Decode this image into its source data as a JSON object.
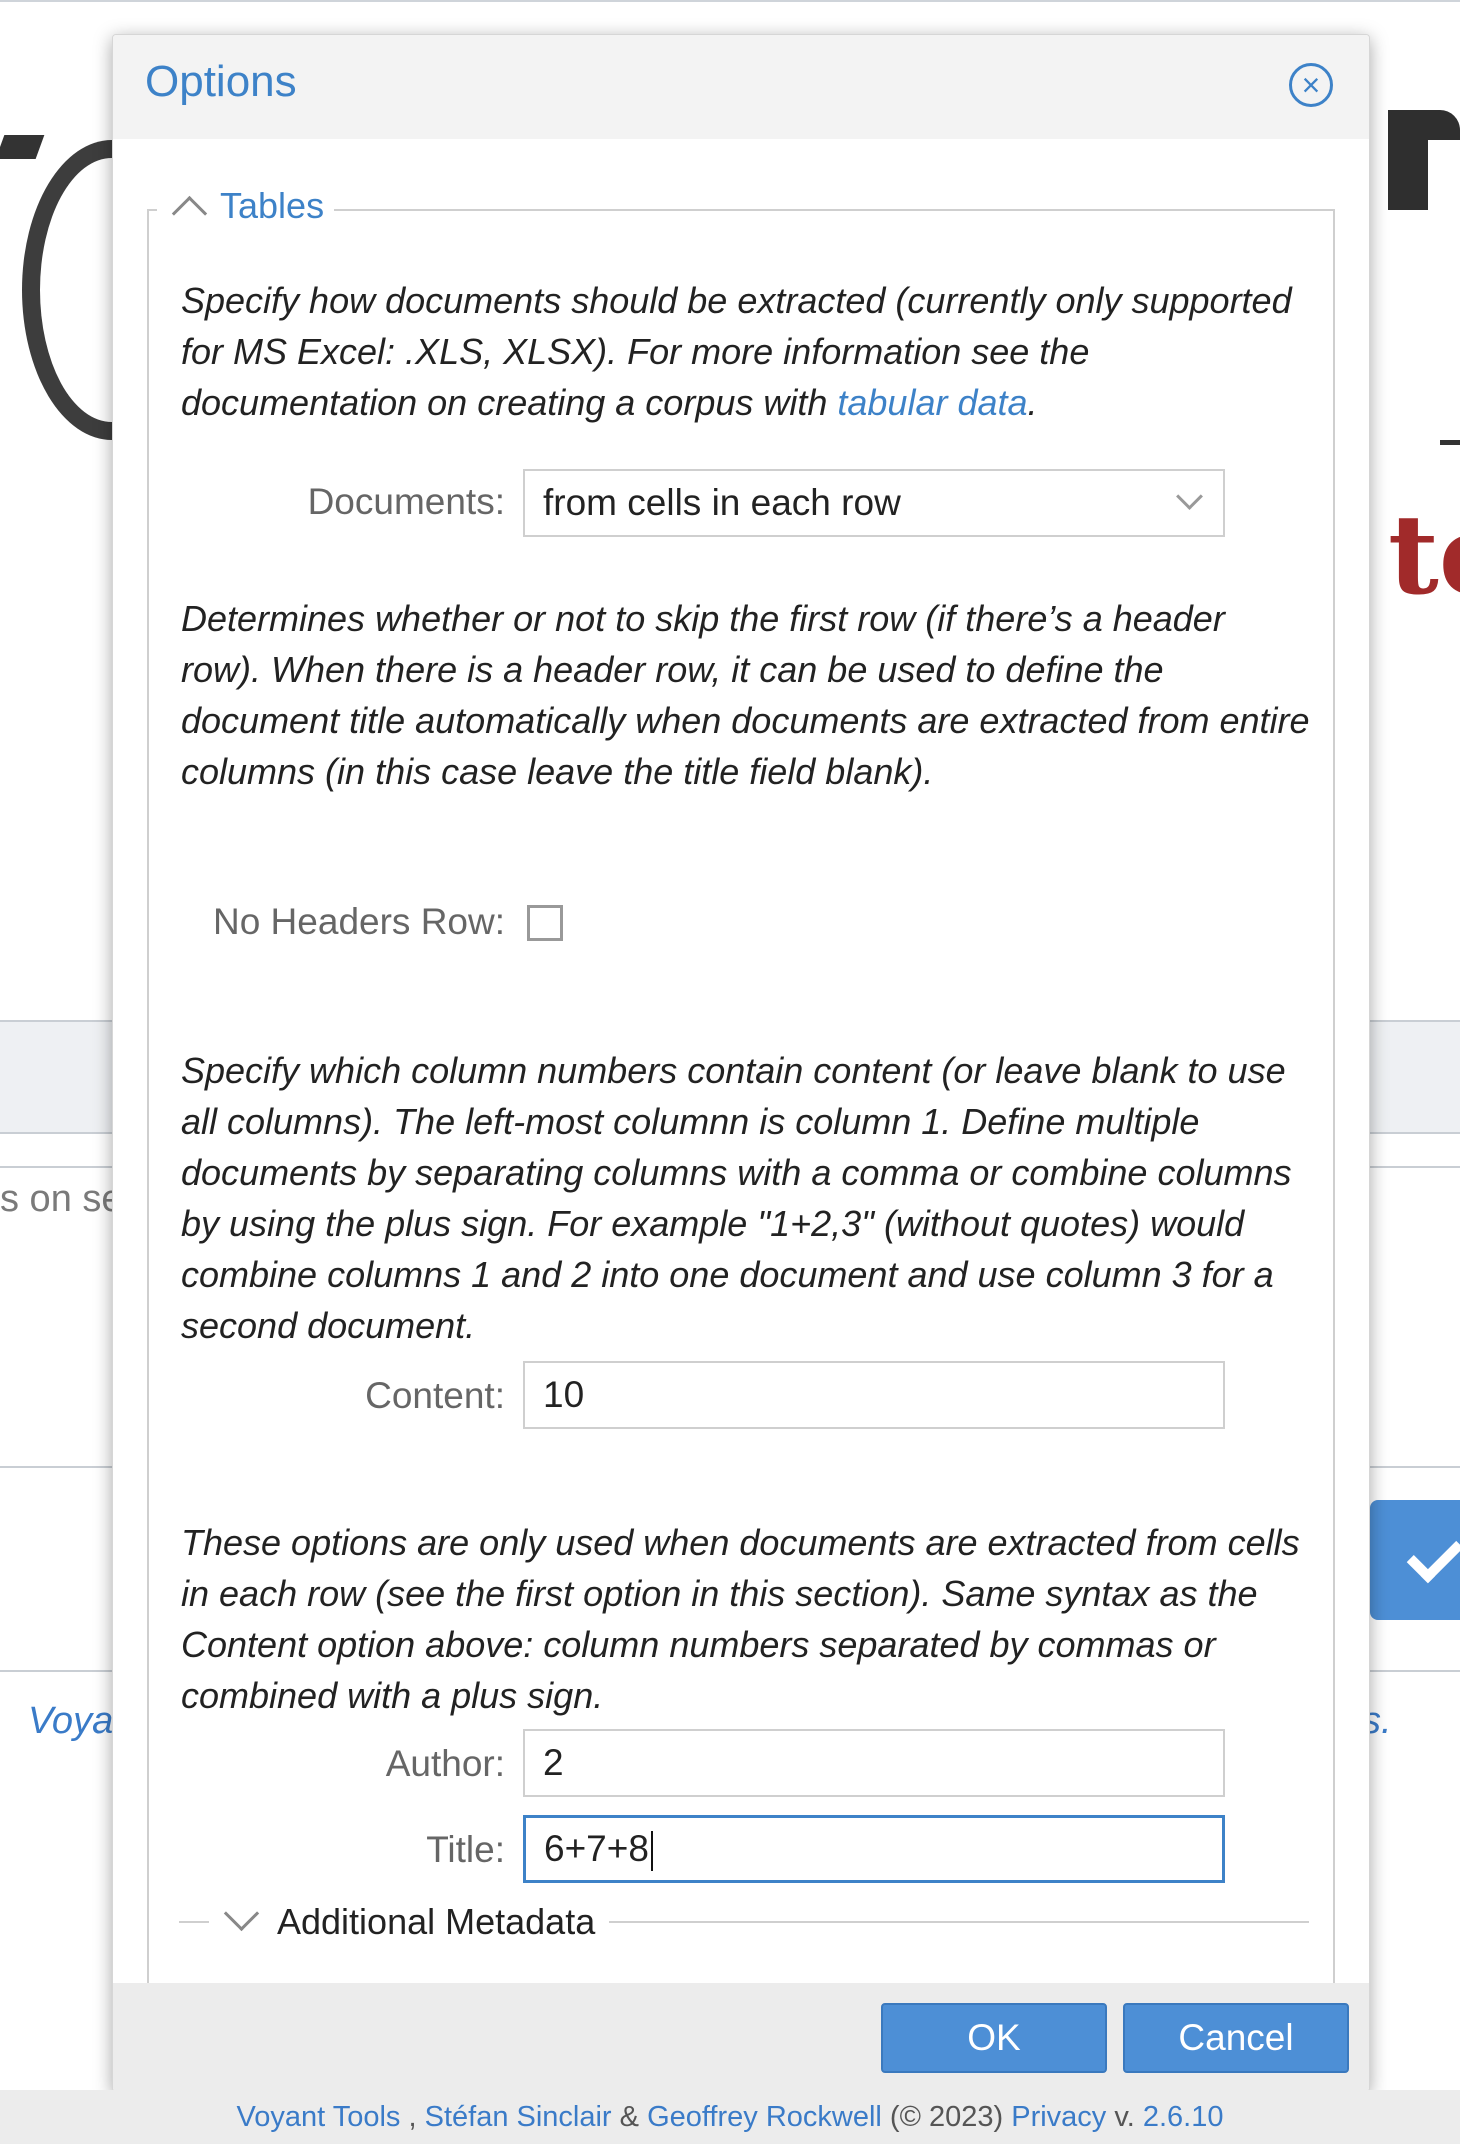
{
  "background": {
    "left_text": "s on se",
    "voyant_partial": "Voya",
    "right_partial": "s.",
    "logo_partial": "te"
  },
  "dialog": {
    "title": "Options",
    "close_icon": "close-circle-icon",
    "section": {
      "legend": "Tables",
      "chevron_icon": "chevron-up-icon",
      "desc1_text": "Specify how documents should be extracted (currently only supported for MS Excel: .XLS, XLSX). For more information see the documentation on creating a corpus with ",
      "desc1_link": "tabular data",
      "desc1_end": ".",
      "documents_label": "Documents:",
      "documents_value": "from cells in each row",
      "desc2": "Determines whether or not to skip the first row (if there’s a header row). When there is a header row, it can be used to define the document title automatically when documents are extracted from entire columns (in this case leave the title field blank).",
      "no_headers_label": "No Headers Row:",
      "no_headers_checked": false,
      "desc3": "Specify which column numbers contain content (or leave blank to use all columns). The left-most columnn is column 1. Define multiple documents by separating columns with a comma or combine columns by using the plus sign. For example \"1+2,3\" (without quotes) would combine columns 1 and 2 into one document and use column 3 for a second document.",
      "content_label": "Content:",
      "content_value": "10",
      "desc4": "These options are only used when documents are extracted from cells in each row (see the first option in this section). Same syntax as the Content option above: column numbers separated by commas or combined with a plus sign.",
      "author_label": "Author:",
      "author_value": "2",
      "title_label": "Title:",
      "title_value": "6+7+8",
      "additional_metadata": "Additional Metadata"
    },
    "ok_label": "OK",
    "cancel_label": "Cancel"
  },
  "footer": {
    "voyant": "Voyant Tools",
    "sep1": " , ",
    "author1": "Stéfan Sinclair",
    "amp": " & ",
    "author2": "Geoffrey Rockwell",
    "copyright": " (© 2023) ",
    "privacy": "Privacy",
    "version_prefix": " v. ",
    "version": "2.6.10"
  },
  "colors": {
    "accent": "#3d82c8",
    "button": "#4d8fd6",
    "logo_red": "#a12a2a"
  }
}
